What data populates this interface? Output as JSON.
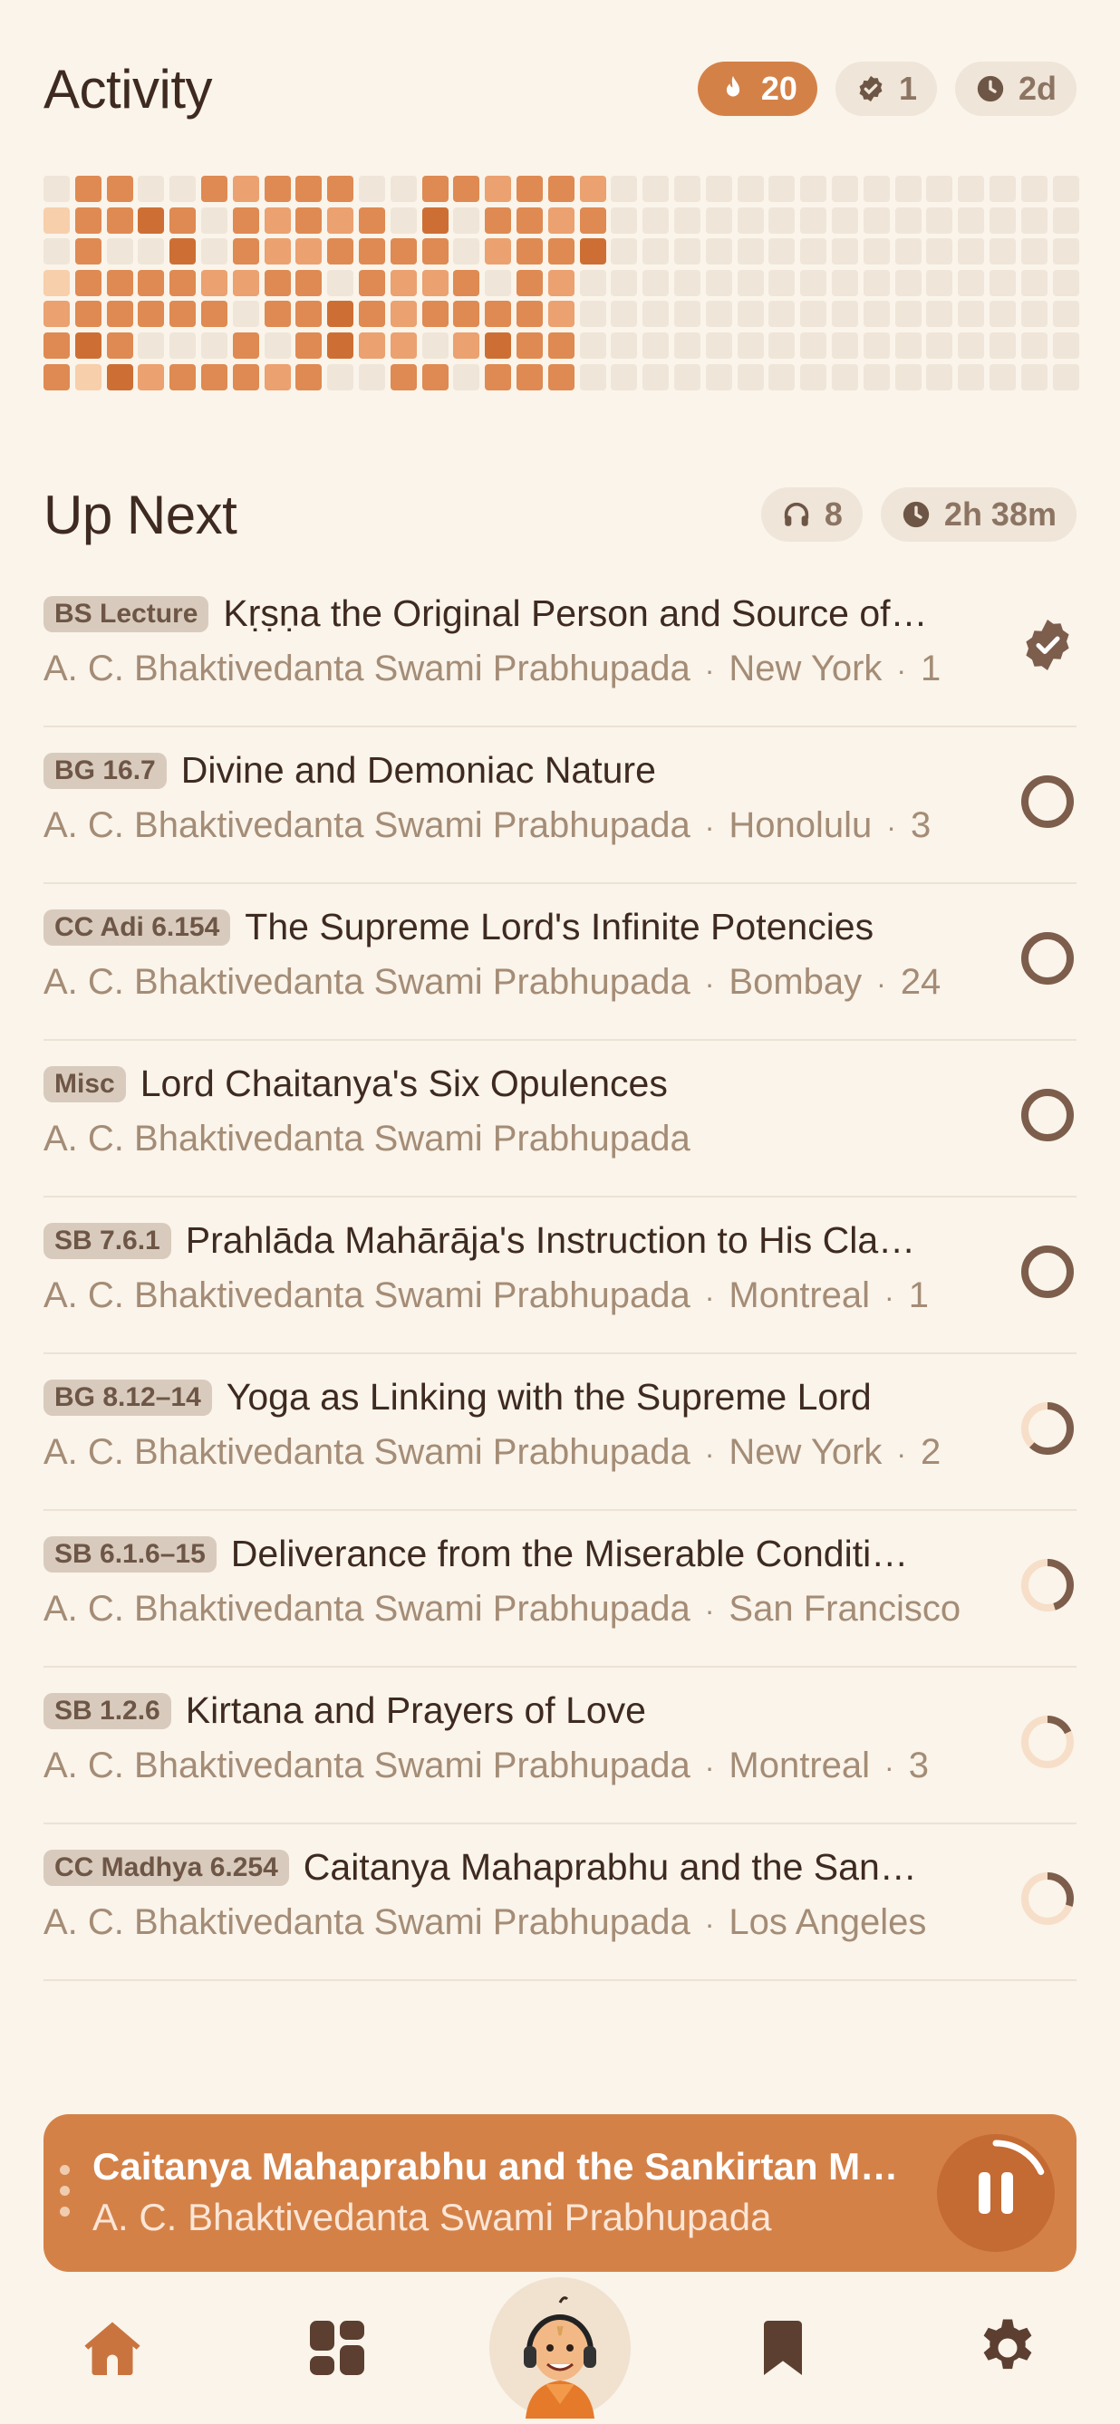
{
  "activity": {
    "title": "Activity",
    "streak": "20",
    "completed": "1",
    "days": "2d",
    "colors": [
      "#efe6d9",
      "#f7cfab",
      "#eba170",
      "#de8a52",
      "#cd6f34"
    ],
    "heatmap_levels": [
      [
        0,
        3,
        3,
        0,
        0,
        3,
        2,
        3,
        3,
        3,
        0,
        0,
        3,
        3,
        2,
        3,
        3,
        2,
        0,
        0,
        0,
        0,
        0,
        0,
        0,
        0,
        0,
        0,
        0,
        0,
        0,
        0,
        0
      ],
      [
        1,
        3,
        3,
        4,
        3,
        0,
        3,
        2,
        3,
        2,
        3,
        0,
        4,
        0,
        3,
        3,
        2,
        3,
        0,
        0,
        0,
        0,
        0,
        0,
        0,
        0,
        0,
        0,
        0,
        0,
        0,
        0,
        0
      ],
      [
        0,
        3,
        0,
        0,
        4,
        0,
        3,
        2,
        2,
        3,
        3,
        3,
        3,
        0,
        2,
        3,
        3,
        4,
        0,
        0,
        0,
        0,
        0,
        0,
        0,
        0,
        0,
        0,
        0,
        0,
        0,
        0,
        0
      ],
      [
        1,
        3,
        3,
        3,
        3,
        2,
        2,
        3,
        3,
        0,
        3,
        2,
        2,
        3,
        0,
        3,
        2,
        0,
        0,
        0,
        0,
        0,
        0,
        0,
        0,
        0,
        0,
        0,
        0,
        0,
        0,
        0,
        0
      ],
      [
        2,
        3,
        3,
        3,
        3,
        3,
        0,
        3,
        3,
        4,
        3,
        2,
        3,
        3,
        3,
        3,
        2,
        0,
        0,
        0,
        0,
        0,
        0,
        0,
        0,
        0,
        0,
        0,
        0,
        0,
        0,
        0,
        0
      ],
      [
        3,
        4,
        3,
        0,
        0,
        0,
        3,
        0,
        3,
        4,
        2,
        2,
        0,
        2,
        4,
        3,
        3,
        0,
        0,
        0,
        0,
        0,
        0,
        0,
        0,
        0,
        0,
        0,
        0,
        0,
        0,
        0,
        0
      ],
      [
        3,
        1,
        4,
        2,
        3,
        3,
        3,
        2,
        3,
        0,
        0,
        3,
        3,
        0,
        3,
        3,
        3,
        0,
        0,
        0,
        0,
        0,
        0,
        0,
        0,
        0,
        0,
        0,
        0,
        0,
        0,
        0,
        0
      ]
    ]
  },
  "upnext": {
    "title": "Up Next",
    "count": "8",
    "duration": "2h 38m",
    "items": [
      {
        "badge": "BS Lecture",
        "title": "Kṛṣṇa the Original Person and Source of…",
        "author": "A. C. Bhaktivedanta Swami Prabhupada",
        "place": "New York",
        "extra": "1",
        "status": "done",
        "progress": 1
      },
      {
        "badge": "BG 16.7",
        "title": "Divine and Demoniac Nature",
        "author": "A. C. Bhaktivedanta Swami Prabhupada",
        "place": "Honolulu",
        "extra": "3",
        "status": "empty",
        "progress": 0
      },
      {
        "badge": "CC Adi 6.154",
        "title": "The Supreme Lord's Infinite Potencies",
        "author": "A. C. Bhaktivedanta Swami Prabhupada",
        "place": "Bombay",
        "extra": "24",
        "status": "empty",
        "progress": 0
      },
      {
        "badge": "Misc",
        "title": "Lord Chaitanya's Six Opulences",
        "author": "A. C. Bhaktivedanta Swami Prabhupada",
        "place": "",
        "extra": "",
        "status": "empty",
        "progress": 0
      },
      {
        "badge": "SB 7.6.1",
        "title": "Prahlāda Mahārāja's Instruction to His Cla…",
        "author": "A. C. Bhaktivedanta Swami Prabhupada",
        "place": "Montreal",
        "extra": "1",
        "status": "empty",
        "progress": 0
      },
      {
        "badge": "BG 8.12–14",
        "title": "Yoga as Linking with the Supreme Lord",
        "author": "A. C. Bhaktivedanta Swami Prabhupada",
        "place": "New York",
        "extra": "2",
        "status": "partial",
        "progress": 0.62
      },
      {
        "badge": "SB 6.1.6–15",
        "title": "Deliverance from the Miserable Conditi…",
        "author": "A. C. Bhaktivedanta Swami Prabhupada",
        "place": "San Francisco",
        "extra": "",
        "status": "partial",
        "progress": 0.45
      },
      {
        "badge": "SB 1.2.6",
        "title": "Kirtana and Prayers of Love",
        "author": "A. C. Bhaktivedanta Swami Prabhupada",
        "place": "Montreal",
        "extra": "3",
        "status": "partial",
        "progress": 0.18
      },
      {
        "badge": "CC Madhya 6.254",
        "title": "Caitanya Mahaprabhu and the San…",
        "author": "A. C. Bhaktivedanta Swami Prabhupada",
        "place": "Los Angeles",
        "extra": "",
        "status": "partial",
        "progress": 0.3
      }
    ]
  },
  "player": {
    "title": "Caitanya Mahaprabhu and the Sankirtan M…",
    "subtitle": "A. C. Bhaktivedanta Swami Prabhupada",
    "progress": 0.18
  },
  "nav": {
    "items": [
      "home-icon",
      "grid-icon",
      "avatar",
      "bookmark-icon",
      "gear-icon"
    ]
  }
}
